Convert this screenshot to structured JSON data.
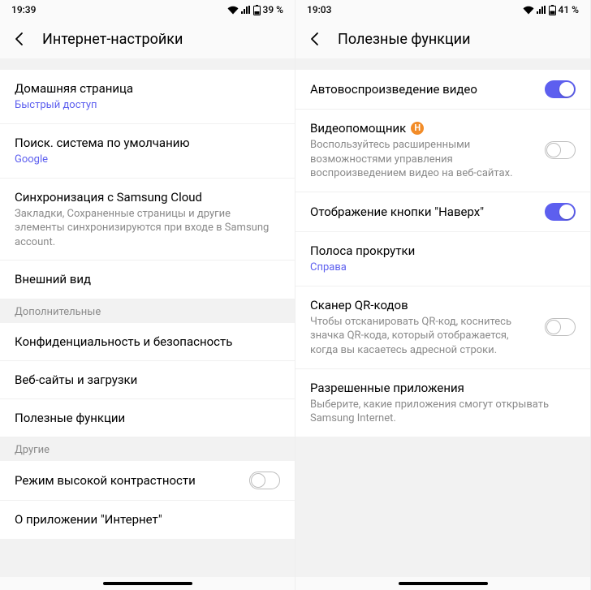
{
  "left": {
    "status": {
      "time": "19:39",
      "battery": "39 %"
    },
    "header": {
      "title": "Интернет-настройки"
    },
    "items": {
      "home_title": "Домашняя страница",
      "home_sub": "Быстрый доступ",
      "search_title": "Поиск. система по умолчанию",
      "search_sub": "Google",
      "sync_title": "Синхронизация с Samsung Cloud",
      "sync_sub": "Закладки, Сохраненные страницы и другие элементы синхронизируются при входе в Samsung account.",
      "appearance_title": "Внешний вид",
      "section_additional": "Дополнительные",
      "privacy_title": "Конфиденциальность и безопасность",
      "sites_title": "Веб-сайты и загрузки",
      "useful_title": "Полезные функции",
      "section_other": "Другие",
      "contrast_title": "Режим высокой контрастности",
      "about_title": "О приложении \"Интернет\""
    }
  },
  "right": {
    "status": {
      "time": "19:03",
      "battery": "41 %"
    },
    "header": {
      "title": "Полезные функции"
    },
    "items": {
      "autoplay_title": "Автовоспроизведение видео",
      "assistant_title": "Видеопомощник",
      "assistant_badge": "Н",
      "assistant_sub": "Воспользуйтесь расширенными возможностями управления воспроизведением видео на веб-сайтах.",
      "top_button_title": "Отображение кнопки \"Наверх\"",
      "scroll_title": "Полоса прокрутки",
      "scroll_sub": "Справа",
      "qr_title": "Сканер QR-кодов",
      "qr_sub": "Чтобы отсканировать QR-код, коснитесь значка QR-кода, который отображается, когда вы касаетесь адресной строки.",
      "apps_title": "Разрешенные приложения",
      "apps_sub": "Выберите, какие приложения смогут открывать Samsung Internet."
    }
  }
}
